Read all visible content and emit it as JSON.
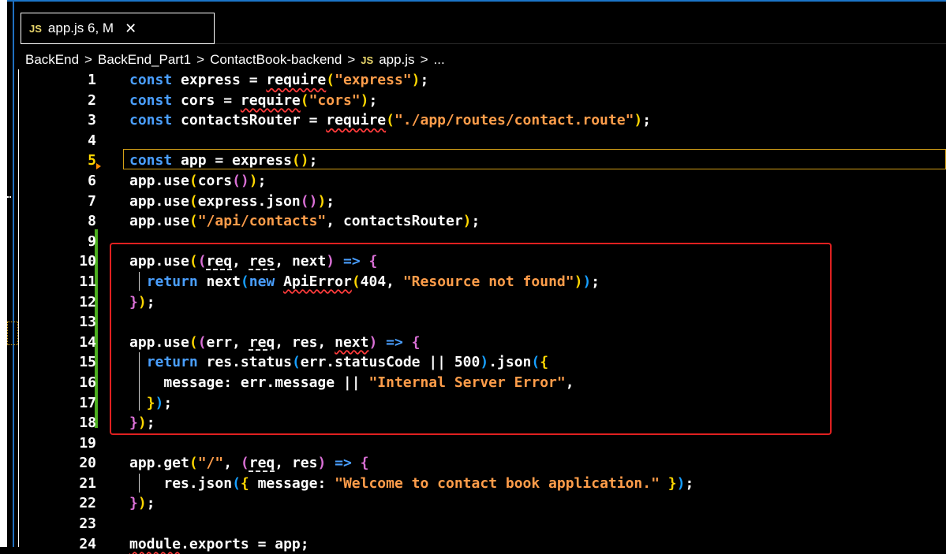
{
  "tab": {
    "badge": "JS",
    "title": "app.js 6, M",
    "close": "✕"
  },
  "breadcrumb": {
    "items": [
      "BackEnd",
      "BackEnd_Part1",
      "ContactBook-backend"
    ],
    "separator": ">",
    "file_badge": "JS",
    "file": "app.js",
    "more": "..."
  },
  "lines": [
    "1",
    "2",
    "3",
    "4",
    "5",
    "6",
    "7",
    "8",
    "9",
    "10",
    "11",
    "12",
    "13",
    "14",
    "15",
    "16",
    "17",
    "18",
    "19",
    "20",
    "21",
    "22",
    "23",
    "24"
  ],
  "code": {
    "c1_kw": "const",
    "c1_var": " express = ",
    "c1_fn": "require",
    "c1_str": "\"express\"",
    "c2_kw": "const",
    "c2_var": " cors = ",
    "c2_fn": "require",
    "c2_str": "\"cors\"",
    "c3_kw": "const",
    "c3_var": " contactsRouter = ",
    "c3_fn": "require",
    "c3_str": "\"./app/routes/contact.route\"",
    "c5_kw": "const",
    "c5_var": " app = express",
    "c6_a": "app.use",
    "c6_b": "cors",
    "c7_a": "app.use",
    "c7_b": "express.json",
    "c8_a": "app.use",
    "c8_str": "\"/api/contacts\"",
    "c8_b": ", contactsRouter",
    "c10_a": "app.use",
    "c10_req": "req",
    "c10_b": ", ",
    "c10_res": "res",
    "c10_c": ", next",
    "c10_arrow": " => ",
    "c11_kw": "return",
    "c11_a": " next",
    "c11_new": "new",
    "c11_err": "ApiError",
    "c11_num": "404, ",
    "c11_str": "\"Resource not found\"",
    "c14_a": "app.use",
    "c14_err": "err, ",
    "c14_req": "req",
    "c14_res": ", res, ",
    "c14_next": "next",
    "c14_arrow": " => ",
    "c15_kw": "return",
    "c15_a": " res.status",
    "c15_b": "err.statusCode || 500",
    "c15_c": ".json",
    "c16_a": "message: err.message || ",
    "c16_str": "\"Internal Server Error\"",
    "c16_b": ",",
    "c20_a": "app.get",
    "c20_str": "\"/\"",
    "c20_b": ", ",
    "c20_req": "req",
    "c20_c": ", res",
    "c20_arrow": " => ",
    "c21_a": "res.json",
    "c21_b": " message: ",
    "c21_str": "\"Welcome to contact book application.\"",
    "c24_mod": "module",
    "c24_b": ".exports = app;"
  }
}
